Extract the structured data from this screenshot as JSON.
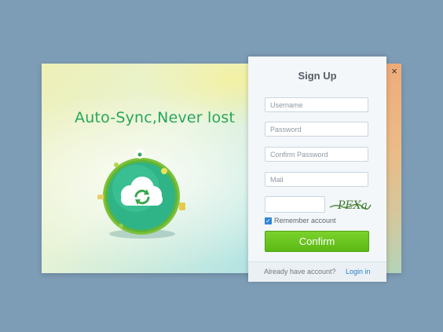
{
  "promo": {
    "tagline": "Auto-Sync,Never lost",
    "illustration": "cloud-sync-globe"
  },
  "window": {
    "close_symbol": "×"
  },
  "signup": {
    "title": "Sign Up",
    "fields": {
      "username": "Username",
      "password": "Password",
      "confirm_password": "Confirm Password",
      "mail": "Mail",
      "captcha": ""
    },
    "captcha_text": "PEXa",
    "remember_label": "Remember account",
    "remember_checked": true,
    "confirm_label": "Confirm",
    "footer_text": "Already have account?",
    "login_link": "Login in"
  },
  "colors": {
    "accent_green": "#5bb814",
    "tagline_green": "#27a65a",
    "link_blue": "#2d7fc8",
    "background": "#7d9cb5"
  }
}
